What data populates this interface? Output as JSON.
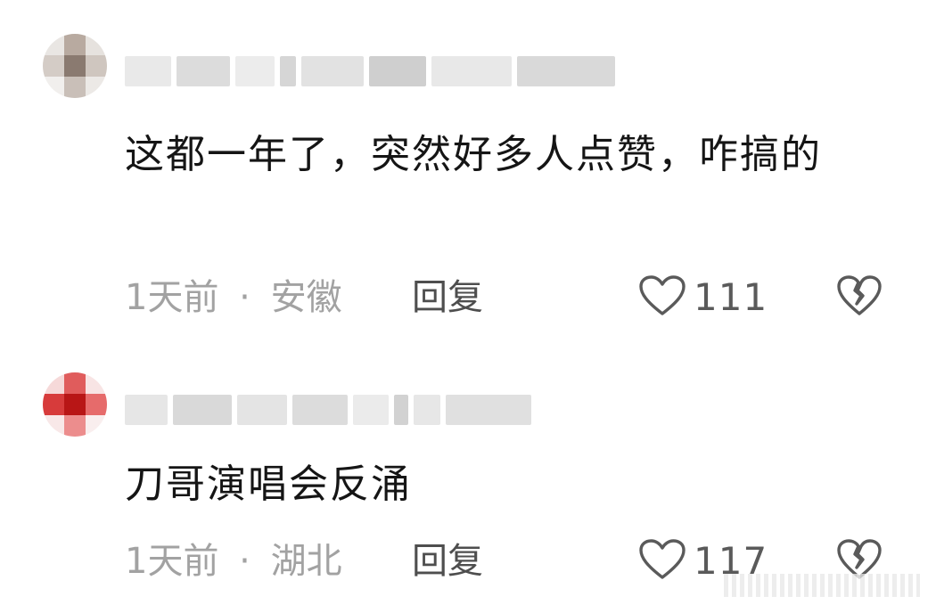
{
  "comments": [
    {
      "text": "这都一年了，突然好多人点赞，咋搞的",
      "time": "1天前",
      "separator": "·",
      "location": "安徽",
      "reply_label": "回复",
      "likes": "111",
      "avatar_colors": [
        "#e9e6e3",
        "#b8aaa0",
        "#e6e2de",
        "#d4ccc6",
        "#8a7a70",
        "#cfc6bf",
        "#f1efed",
        "#c9bfb8",
        "#ece9e6"
      ],
      "name_blur_colors": [
        "#e9e9e9",
        "#dcdcdc",
        "#ececec",
        "#d6d6d6",
        "#e2e2e2",
        "#cfcfcf",
        "#e8e8e8",
        "#d9d9d9"
      ],
      "icons": {
        "like": "heart-outline-icon",
        "dislike": "broken-heart-icon"
      }
    },
    {
      "text": "刀哥演唱会反涌",
      "time": "1天前",
      "separator": "·",
      "location": "湖北",
      "reply_label": "回复",
      "likes": "117",
      "avatar_colors": [
        "#f6d9d9",
        "#e05c5c",
        "#f8e4e4",
        "#d73b3b",
        "#b81616",
        "#e66b6b",
        "#f8e8e8",
        "#ec8d8d",
        "#f9eeee"
      ],
      "name_blur_colors": [
        "#e6e6e6",
        "#d9d9d9",
        "#e4e4e4",
        "#dcdcdc",
        "#ebebeb",
        "#d2d2d2",
        "#e7e7e7",
        "#e0e0e0"
      ],
      "icons": {
        "like": "heart-outline-icon",
        "dislike": "broken-heart-icon"
      }
    }
  ]
}
